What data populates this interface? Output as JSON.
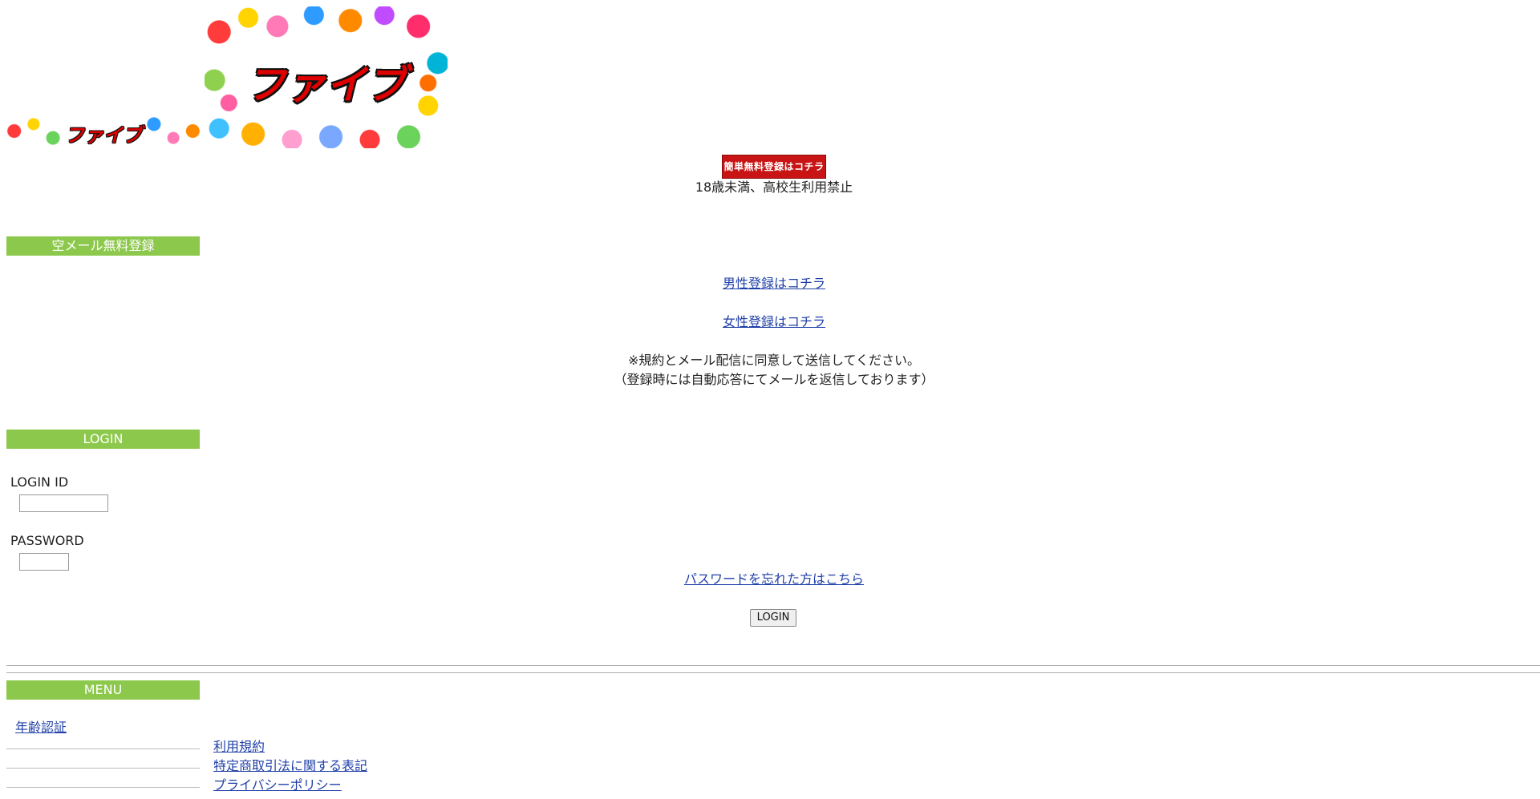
{
  "logo": {
    "small_text": "ファイブ",
    "large_text": "ファイブ"
  },
  "register_button_label": "簡単無料登録はコチラ",
  "age_notice": "18歳未満、高校生利用禁止",
  "empty_mail": {
    "heading": "空メール無料登録",
    "male_link": "男性登録はコチラ",
    "female_link": "女性登録はコチラ",
    "notice_line1": "※規約とメール配信に同意して送信してください。",
    "notice_line2": "（登録時には自動応答にてメールを返信しております）"
  },
  "login": {
    "heading": "LOGIN",
    "id_label": "LOGIN ID",
    "id_value": "",
    "password_label": "PASSWORD",
    "password_value": "",
    "forgot_link": "パスワードを忘れた方はこちら",
    "submit_label": "LOGIN"
  },
  "menu": {
    "heading": "MENU",
    "age_verification": "年齢認証",
    "links": [
      "利用規約",
      "特定商取引法に関する表記",
      "プライバシーポリシー"
    ]
  },
  "colors": {
    "green_bar": "#8cc84b",
    "register_red": "#c81414",
    "link_blue": "#1f3fa8"
  }
}
